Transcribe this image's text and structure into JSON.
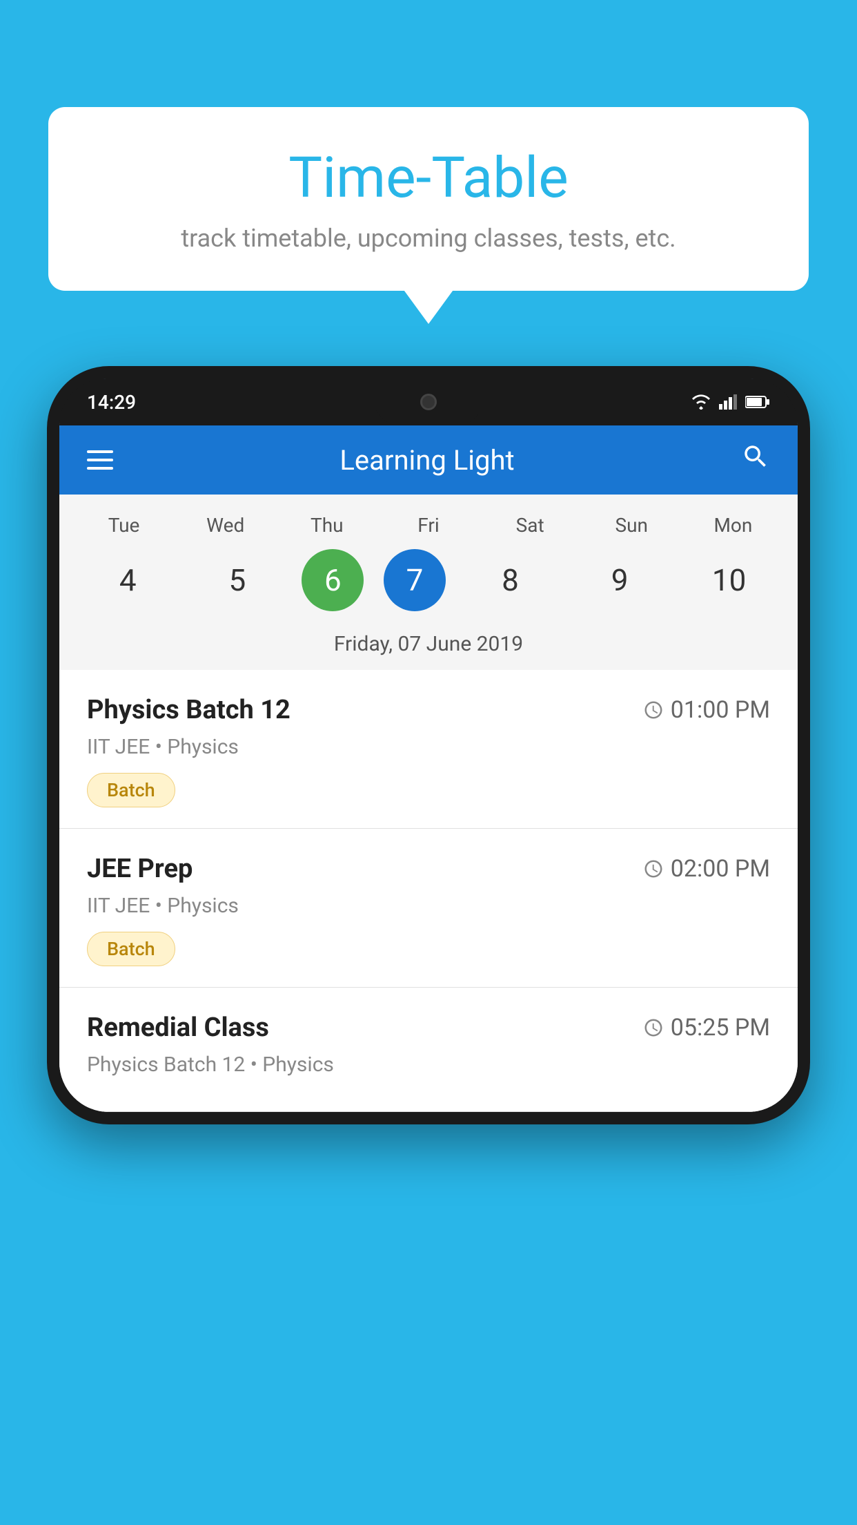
{
  "background_color": "#29b6e8",
  "bubble": {
    "title": "Time-Table",
    "subtitle": "track timetable, upcoming classes, tests, etc."
  },
  "phone": {
    "status_bar": {
      "time": "14:29"
    },
    "app": {
      "title": "Learning Light"
    },
    "calendar": {
      "days": [
        {
          "name": "Tue",
          "number": "4",
          "state": "normal"
        },
        {
          "name": "Wed",
          "number": "5",
          "state": "normal"
        },
        {
          "name": "Thu",
          "number": "6",
          "state": "today"
        },
        {
          "name": "Fri",
          "number": "7",
          "state": "selected"
        },
        {
          "name": "Sat",
          "number": "8",
          "state": "normal"
        },
        {
          "name": "Sun",
          "number": "9",
          "state": "normal"
        },
        {
          "name": "Mon",
          "number": "10",
          "state": "normal"
        }
      ],
      "selected_date_label": "Friday, 07 June 2019"
    },
    "schedule": [
      {
        "name": "Physics Batch 12",
        "time": "01:00 PM",
        "subtitle": "IIT JEE • Physics",
        "badge": "Batch"
      },
      {
        "name": "JEE Prep",
        "time": "02:00 PM",
        "subtitle": "IIT JEE • Physics",
        "badge": "Batch"
      },
      {
        "name": "Remedial Class",
        "time": "05:25 PM",
        "subtitle": "Physics Batch 12 • Physics",
        "badge": null
      }
    ]
  },
  "icons": {
    "hamburger": "☰",
    "search": "🔍",
    "clock": "🕐"
  }
}
